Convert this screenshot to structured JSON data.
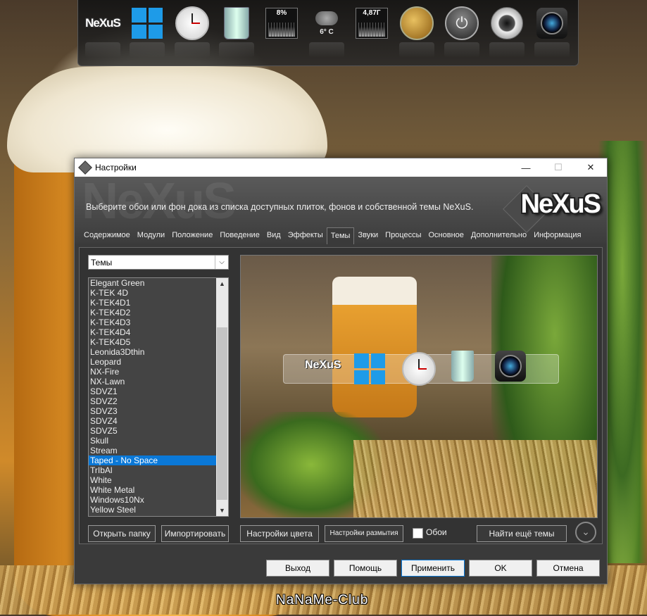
{
  "dock": {
    "nexus_label": "NeXuS",
    "cpu_meter": "8%",
    "weather_temp": "6° C",
    "ram_meter": "4,87Г",
    "icons": [
      "nexus-logo-icon",
      "windows-icon",
      "clock-icon",
      "recycle-bin-icon",
      "cpu-meter-icon",
      "weather-icon",
      "ram-meter-icon",
      "globe-network-icon",
      "power-icon",
      "speaker-icon",
      "camera-icon"
    ]
  },
  "window": {
    "title": "Настройки",
    "minimize": "—",
    "maximize": "☐",
    "close": "✕",
    "header_description": "Выберите обои или фон дока из списка доступных плиток, фонов и собственной темы NeXuS.",
    "logo_text": "NeXuS",
    "watermark_text": "NeXuS",
    "tabs": [
      "Содержимое",
      "Модули",
      "Положение",
      "Поведение",
      "Вид",
      "Эффекты",
      "Темы",
      "Звуки",
      "Процессы",
      "Основное",
      "Дополнительно",
      "Информация"
    ],
    "active_tab": "Темы"
  },
  "themes": {
    "combo_value": "Темы",
    "combo_arrow": "⌵",
    "items": [
      "Elegant Green",
      "K-TEK 4D",
      "K-TEK4D1",
      "K-TEK4D2",
      "K-TEK4D3",
      "K-TEK4D4",
      "K-TEK4D5",
      "Leonida3Dthin",
      "Leopard",
      "NX-Fire",
      "NX-Lawn",
      "SDVZ1",
      "SDVZ2",
      "SDVZ3",
      "SDVZ4",
      "SDVZ5",
      "Skull",
      "Stream",
      "Taped - No Space",
      "TrIbAl",
      "White",
      "White Metal",
      "Windows10Nx",
      "Yellow Steel"
    ],
    "selected": "Taped - No Space",
    "scroll_up": "▲",
    "scroll_down": "▼"
  },
  "preview": {
    "nexus_label": "NeXuS"
  },
  "buttons": {
    "open_folder": "Открыть папку",
    "import": "Импортировать",
    "color_settings": "Настройки цвета",
    "blur_settings": "Настройки размытия",
    "wallpaper_checkbox": "Обои",
    "find_more": "Найти ещё темы",
    "expand": "⌄",
    "exit": "Выход",
    "help": "Помощь",
    "apply": "Применить",
    "ok": "OK",
    "cancel": "Отмена"
  },
  "footer": {
    "watermark": "NaNaMe-Club"
  },
  "colors": {
    "accent": "#0a78d7",
    "windows_blue": "#1e9be8"
  }
}
